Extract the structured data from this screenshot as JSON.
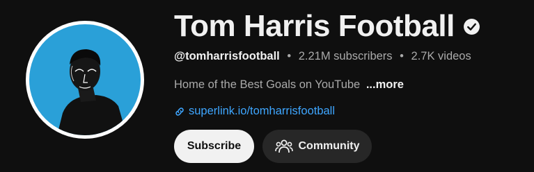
{
  "channel": {
    "name": "Tom Harris Football",
    "verified_icon": "verified-check-icon",
    "handle": "@tomharrisfootball",
    "subscribers": "2.21M subscribers",
    "videos": "2.7K videos",
    "separator": "•",
    "description": "Home of the Best Goals on YouTube",
    "more_label": "...more",
    "link_icon": "link-icon",
    "link_text": "superlink.io/tomharrisfootball"
  },
  "actions": {
    "subscribe_label": "Subscribe",
    "community_label": "Community",
    "community_icon": "community-people-icon"
  },
  "colors": {
    "background": "#0f0f0f",
    "avatar_bg": "#2aa0d8",
    "link": "#3ea6ff",
    "subscribe_bg": "#f1f1f1",
    "community_bg": "#272727"
  }
}
